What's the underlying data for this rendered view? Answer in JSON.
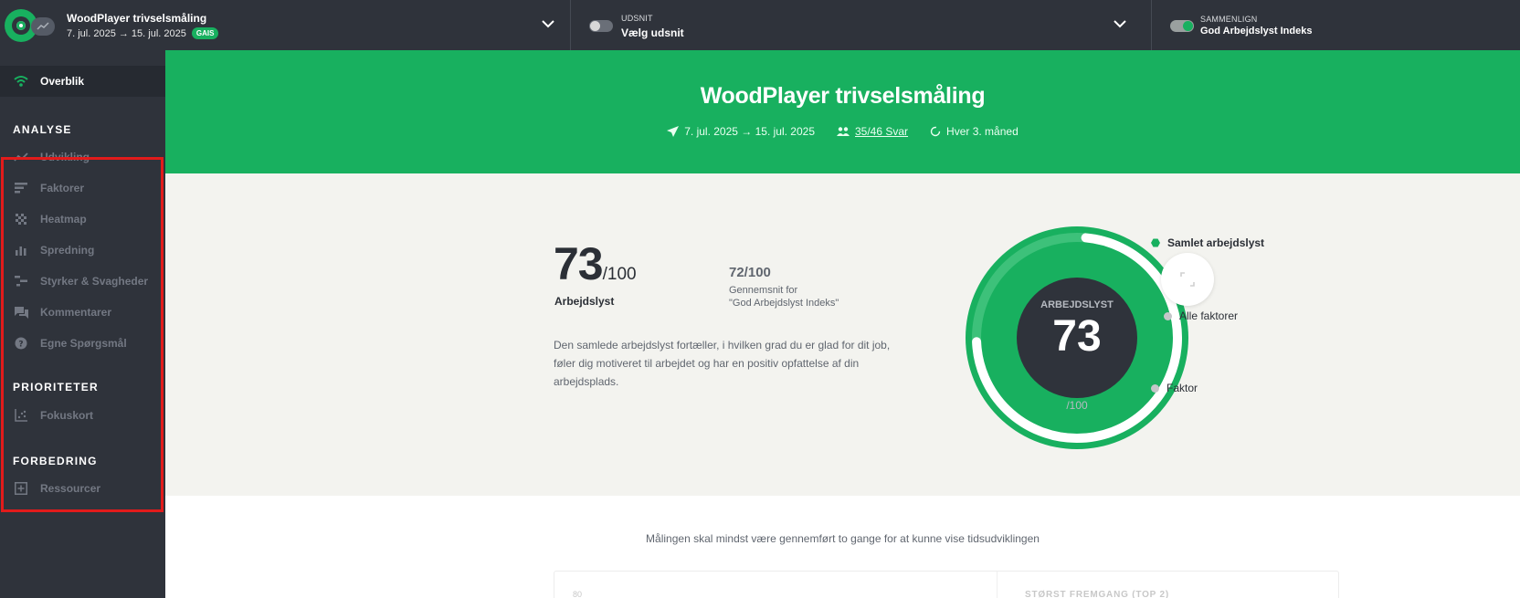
{
  "topbar": {
    "survey_title": "WoodPlayer trivselsmåling",
    "survey_dates": "7. jul. 2025 → 15. jul. 2025",
    "badge": "GAIS",
    "udsnit_caption": "UDSNIT",
    "udsnit_value": "Vælg udsnit",
    "compare_caption": "SAMMENLIGN",
    "compare_value": "God Arbejdslyst Indeks"
  },
  "sidebar": {
    "overview": "Overblik",
    "section_analyse": "ANALYSE",
    "analyse_items": [
      "Udvikling",
      "Faktorer",
      "Heatmap",
      "Spredning",
      "Styrker & Svagheder",
      "Kommentarer",
      "Egne Spørgsmål"
    ],
    "section_prioriteter": "PRIORITETER",
    "prioriteter_items": [
      "Fokuskort"
    ],
    "section_forbedring": "FORBEDRING",
    "forbedring_items": [
      "Ressourcer"
    ]
  },
  "hero": {
    "title": "WoodPlayer trivselsmåling",
    "dates": "7. jul. 2025 → 15. jul. 2025",
    "responses": "35/46 Svar",
    "frequency": "Hver 3. måned"
  },
  "summary": {
    "score": "73",
    "score_denominator": "/100",
    "score_label": "Arbejdslyst",
    "avg_score": "72/100",
    "avg_label_line1": "Gennemsnit for",
    "avg_label_line2": "\"God Arbejdslyst Indeks\"",
    "description": "Den samlede arbejdslyst fortæller, i hvilken grad du er glad for dit job, føler dig motiveret til arbejdet og har en positiv opfattelse af din arbejdsplads.",
    "gauge_label": "ARBEJDSLYST",
    "gauge_value": "73",
    "gauge_denominator": "/100",
    "gauge_fraction": 0.73,
    "legend": [
      "Samlet arbejdslyst",
      "Alle faktorer",
      "Faktor"
    ]
  },
  "lower": {
    "notice": "Målingen skal mindst være gennemført to gange for at kunne vise tidsudviklingen",
    "axis_value": "80",
    "top_progress": "STØRST FREMGANG (TOP 2)"
  },
  "colors": {
    "brand_green": "#18b05f",
    "sidebar_bg": "#2f333b",
    "highlight_red": "#e21b1b"
  }
}
